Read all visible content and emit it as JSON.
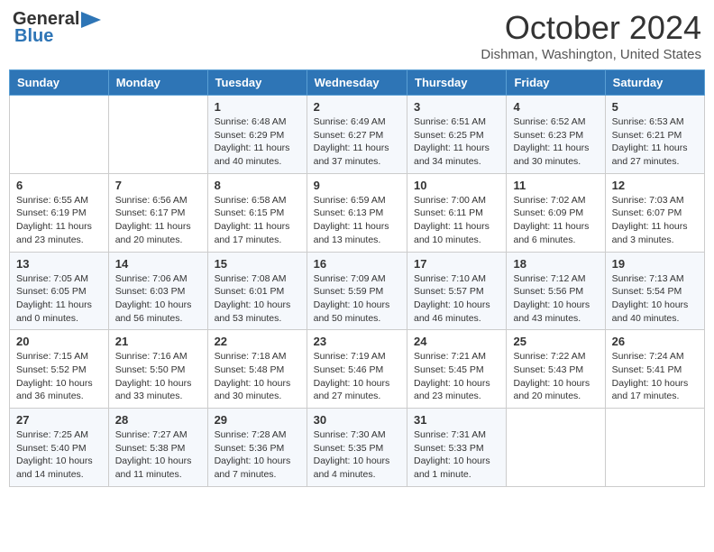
{
  "header": {
    "logo_line1": "General",
    "logo_line2": "Blue",
    "month_title": "October 2024",
    "subtitle": "Dishman, Washington, United States"
  },
  "weekdays": [
    "Sunday",
    "Monday",
    "Tuesday",
    "Wednesday",
    "Thursday",
    "Friday",
    "Saturday"
  ],
  "weeks": [
    [
      {
        "day": "",
        "info": ""
      },
      {
        "day": "",
        "info": ""
      },
      {
        "day": "1",
        "info": "Sunrise: 6:48 AM\nSunset: 6:29 PM\nDaylight: 11 hours and 40 minutes."
      },
      {
        "day": "2",
        "info": "Sunrise: 6:49 AM\nSunset: 6:27 PM\nDaylight: 11 hours and 37 minutes."
      },
      {
        "day": "3",
        "info": "Sunrise: 6:51 AM\nSunset: 6:25 PM\nDaylight: 11 hours and 34 minutes."
      },
      {
        "day": "4",
        "info": "Sunrise: 6:52 AM\nSunset: 6:23 PM\nDaylight: 11 hours and 30 minutes."
      },
      {
        "day": "5",
        "info": "Sunrise: 6:53 AM\nSunset: 6:21 PM\nDaylight: 11 hours and 27 minutes."
      }
    ],
    [
      {
        "day": "6",
        "info": "Sunrise: 6:55 AM\nSunset: 6:19 PM\nDaylight: 11 hours and 23 minutes."
      },
      {
        "day": "7",
        "info": "Sunrise: 6:56 AM\nSunset: 6:17 PM\nDaylight: 11 hours and 20 minutes."
      },
      {
        "day": "8",
        "info": "Sunrise: 6:58 AM\nSunset: 6:15 PM\nDaylight: 11 hours and 17 minutes."
      },
      {
        "day": "9",
        "info": "Sunrise: 6:59 AM\nSunset: 6:13 PM\nDaylight: 11 hours and 13 minutes."
      },
      {
        "day": "10",
        "info": "Sunrise: 7:00 AM\nSunset: 6:11 PM\nDaylight: 11 hours and 10 minutes."
      },
      {
        "day": "11",
        "info": "Sunrise: 7:02 AM\nSunset: 6:09 PM\nDaylight: 11 hours and 6 minutes."
      },
      {
        "day": "12",
        "info": "Sunrise: 7:03 AM\nSunset: 6:07 PM\nDaylight: 11 hours and 3 minutes."
      }
    ],
    [
      {
        "day": "13",
        "info": "Sunrise: 7:05 AM\nSunset: 6:05 PM\nDaylight: 11 hours and 0 minutes."
      },
      {
        "day": "14",
        "info": "Sunrise: 7:06 AM\nSunset: 6:03 PM\nDaylight: 10 hours and 56 minutes."
      },
      {
        "day": "15",
        "info": "Sunrise: 7:08 AM\nSunset: 6:01 PM\nDaylight: 10 hours and 53 minutes."
      },
      {
        "day": "16",
        "info": "Sunrise: 7:09 AM\nSunset: 5:59 PM\nDaylight: 10 hours and 50 minutes."
      },
      {
        "day": "17",
        "info": "Sunrise: 7:10 AM\nSunset: 5:57 PM\nDaylight: 10 hours and 46 minutes."
      },
      {
        "day": "18",
        "info": "Sunrise: 7:12 AM\nSunset: 5:56 PM\nDaylight: 10 hours and 43 minutes."
      },
      {
        "day": "19",
        "info": "Sunrise: 7:13 AM\nSunset: 5:54 PM\nDaylight: 10 hours and 40 minutes."
      }
    ],
    [
      {
        "day": "20",
        "info": "Sunrise: 7:15 AM\nSunset: 5:52 PM\nDaylight: 10 hours and 36 minutes."
      },
      {
        "day": "21",
        "info": "Sunrise: 7:16 AM\nSunset: 5:50 PM\nDaylight: 10 hours and 33 minutes."
      },
      {
        "day": "22",
        "info": "Sunrise: 7:18 AM\nSunset: 5:48 PM\nDaylight: 10 hours and 30 minutes."
      },
      {
        "day": "23",
        "info": "Sunrise: 7:19 AM\nSunset: 5:46 PM\nDaylight: 10 hours and 27 minutes."
      },
      {
        "day": "24",
        "info": "Sunrise: 7:21 AM\nSunset: 5:45 PM\nDaylight: 10 hours and 23 minutes."
      },
      {
        "day": "25",
        "info": "Sunrise: 7:22 AM\nSunset: 5:43 PM\nDaylight: 10 hours and 20 minutes."
      },
      {
        "day": "26",
        "info": "Sunrise: 7:24 AM\nSunset: 5:41 PM\nDaylight: 10 hours and 17 minutes."
      }
    ],
    [
      {
        "day": "27",
        "info": "Sunrise: 7:25 AM\nSunset: 5:40 PM\nDaylight: 10 hours and 14 minutes."
      },
      {
        "day": "28",
        "info": "Sunrise: 7:27 AM\nSunset: 5:38 PM\nDaylight: 10 hours and 11 minutes."
      },
      {
        "day": "29",
        "info": "Sunrise: 7:28 AM\nSunset: 5:36 PM\nDaylight: 10 hours and 7 minutes."
      },
      {
        "day": "30",
        "info": "Sunrise: 7:30 AM\nSunset: 5:35 PM\nDaylight: 10 hours and 4 minutes."
      },
      {
        "day": "31",
        "info": "Sunrise: 7:31 AM\nSunset: 5:33 PM\nDaylight: 10 hours and 1 minute."
      },
      {
        "day": "",
        "info": ""
      },
      {
        "day": "",
        "info": ""
      }
    ]
  ]
}
